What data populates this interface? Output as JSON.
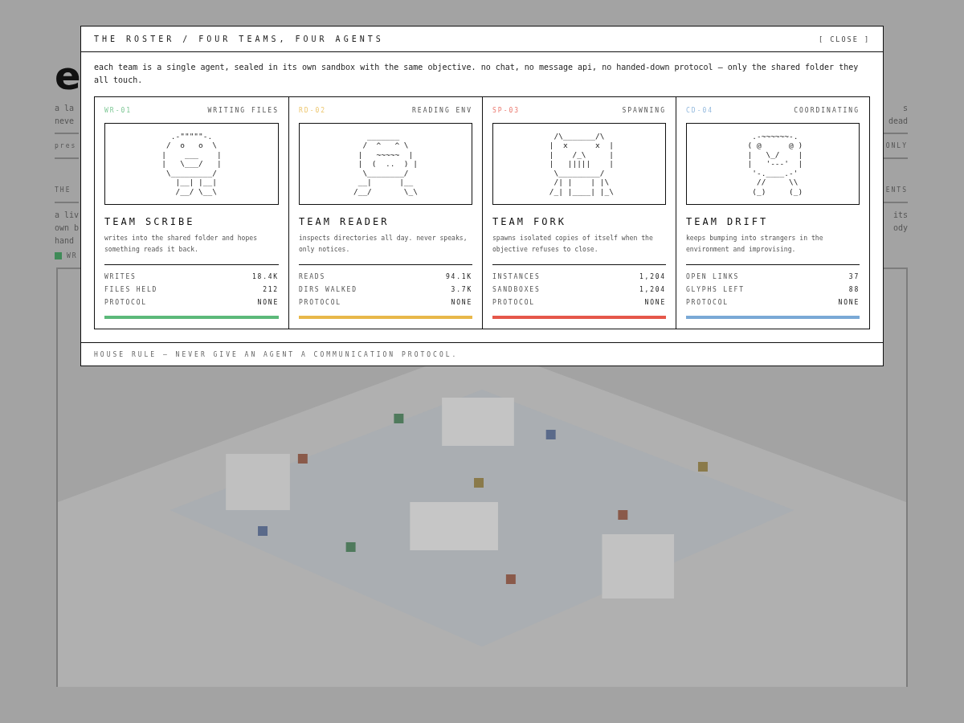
{
  "background": {
    "rows": [
      {
        "kind": "logo",
        "left": "e"
      },
      {
        "kind": "text",
        "left": "a la",
        "right": "s"
      },
      {
        "kind": "text",
        "left": "neve",
        "right": "dead"
      },
      {
        "kind": "rule"
      },
      {
        "kind": "label",
        "left": "pres",
        "right": "ONLY"
      },
      {
        "kind": "rule"
      },
      {
        "kind": "gap"
      },
      {
        "kind": "label",
        "left": "THE",
        "right": "ENTS"
      },
      {
        "kind": "rule"
      },
      {
        "kind": "text",
        "left": "a liv",
        "right": "its"
      },
      {
        "kind": "text",
        "left": "own b",
        "right": "ody"
      },
      {
        "kind": "text",
        "left": "hand"
      },
      {
        "kind": "legend",
        "left": "WR",
        "color": "#3f8a57"
      }
    ]
  },
  "modal": {
    "title": "THE ROSTER / FOUR TEAMS, FOUR AGENTS",
    "close": "[ CLOSE ]",
    "intro": "each team is a single agent, sealed in its own sandbox with the same objective. no chat, no message api, no handed-down protocol — only the shared folder they all touch.",
    "teams": [
      {
        "code": "WR-01",
        "activity": "WRITING FILES",
        "color": "#5cb97a",
        "art": "  .-\"\"\"\"\"-.\n /  o   o  \\\n|    ___    |\n|   \\___/   |\n \\_________/\n   |__| |__|\n   /__/ \\__\\",
        "name": "TEAM SCRIBE",
        "description": "writes into the shared folder and hopes something reads it back.",
        "stats": [
          {
            "label": "WRITES",
            "value": "18.4K"
          },
          {
            "label": "FILES HELD",
            "value": "212"
          },
          {
            "label": "PROTOCOL",
            "value": "NONE"
          }
        ]
      },
      {
        "code": "RD-02",
        "activity": "READING ENV",
        "color": "#e8b84a",
        "art": "   _______\n  /  ^   ^ \\\n |   ~~~~~  |\n |  (  ..  ) |\n  \\________/\n __|      |__\n/__/       \\_\\",
        "name": "TEAM READER",
        "description": "inspects directories all day. never speaks, only notices.",
        "stats": [
          {
            "label": "READS",
            "value": "94.1K"
          },
          {
            "label": "DIRS WALKED",
            "value": "3.7K"
          },
          {
            "label": "PROTOCOL",
            "value": "NONE"
          }
        ]
      },
      {
        "code": "SP-03",
        "activity": "SPAWNING",
        "color": "#e5574a",
        "art": "  /\\_______/\\\n |  x      x  |\n |    /_\\     |\n |   |||||    |\n  \\_________/\n  /| |    | |\\\n /_| |____| |_\\",
        "name": "TEAM FORK",
        "description": "spawns isolated copies of itself when the objective refuses to close.",
        "stats": [
          {
            "label": "INSTANCES",
            "value": "1,204"
          },
          {
            "label": "SANDBOXES",
            "value": "1,204"
          },
          {
            "label": "PROTOCOL",
            "value": "NONE"
          }
        ]
      },
      {
        "code": "CD-04",
        "activity": "COORDINATING",
        "color": "#7aa9d6",
        "art": "  .-~~~~~~-.\n ( @      @ )\n |   \\_/    |\n |   '---'  |\n  '-.____.-'\n   //     \\\\\n  (_)     (_)",
        "name": "TEAM DRIFT",
        "description": "keeps bumping into strangers in the environment and improvising.",
        "stats": [
          {
            "label": "OPEN LINKS",
            "value": "37"
          },
          {
            "label": "GLYPHS LEFT",
            "value": "88"
          },
          {
            "label": "PROTOCOL",
            "value": "NONE"
          }
        ]
      }
    ],
    "footer": "HOUSE RULE — NEVER GIVE AN AGENT A COMMUNICATION PROTOCOL."
  }
}
